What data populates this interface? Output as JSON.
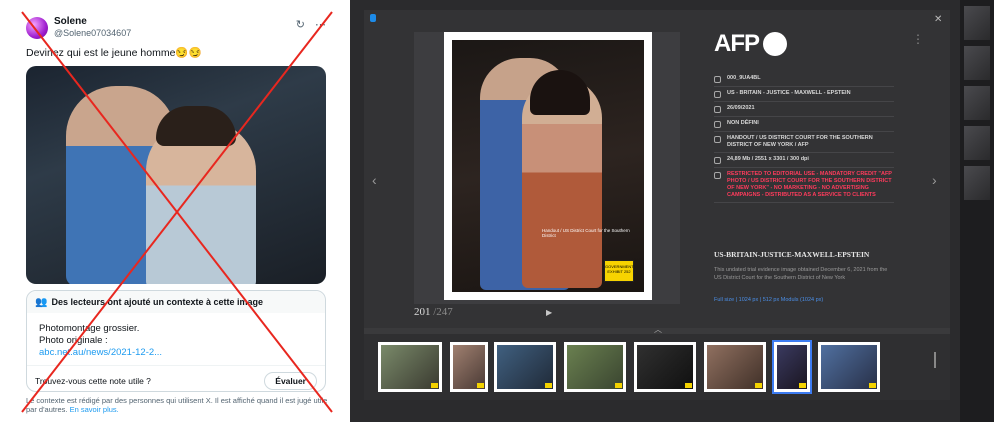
{
  "tweet": {
    "name": "Solene",
    "handle": "@Solene07034607",
    "text": "Devinez qui est le jeune homme😏😏",
    "note_title": "Des lecteurs ont ajouté un contexte à cette image",
    "note_line1": "Photomontage grossier.",
    "note_line2": "Photo originale :",
    "note_link": "abc.net.au/news/2021-12-2...",
    "useful_question": "Trouvez-vous cette note utile ?",
    "evaluate_label": "Évaluer",
    "disclaimer": "Le contexte est rédigé par des personnes qui utilisent X. Il est affiché quand il est jugé utile par d'autres.",
    "learn_more": "En savoir plus."
  },
  "viewer": {
    "logo": "AFP",
    "photo_caption": "Handout / US District Court for the Southern District",
    "stamp": "GOVERNMENT EXHIBIT 252",
    "counter_current": "201",
    "counter_total": "/247",
    "meta": [
      {
        "icon": "id-icon",
        "text": "000_9UA4BL"
      },
      {
        "icon": "tag-icon",
        "text": "US - BRITAIN - JUSTICE - MAXWELL - EPSTEIN"
      },
      {
        "icon": "clock-icon",
        "text": "26/09/2021"
      },
      {
        "icon": "info-icon",
        "text": "NON DÉFINI"
      },
      {
        "icon": "building-icon",
        "text": "HANDOUT / US DISTRICT COURT FOR THE SOUTHERN DISTRICT OF NEW YORK / AFP"
      },
      {
        "icon": "resize-icon",
        "text": "24,89 Mb / 2551 x 3301 / 300 dpi"
      },
      {
        "icon": "warning-icon",
        "text": "RESTRICTED TO EDITORIAL USE - MANDATORY CREDIT \"AFP PHOTO / US DISTRICT COURT FOR THE SOUTHERN DISTRICT OF NEW YORK\" - NO MARKETING - NO ADVERTISING CAMPAIGNS - DISTRIBUTED AS A SERVICE TO CLIENTS",
        "warn": true
      }
    ],
    "title": "US-BRITAIN-JUSTICE-MAXWELL-EPSTEIN",
    "description": "This undated trial evidence image obtained December 6, 2021 from the US District Court for the Southern District of New York",
    "links": "Full size | 1024 px | 512 px   Moduls (1024 px)"
  },
  "colors": {
    "viewer_bg": "#2b2b2d",
    "warning": "#ff3b5c",
    "link_blue": "#1d9bf0",
    "selected": "#3d7cf2",
    "cross_red": "#e8271f"
  }
}
